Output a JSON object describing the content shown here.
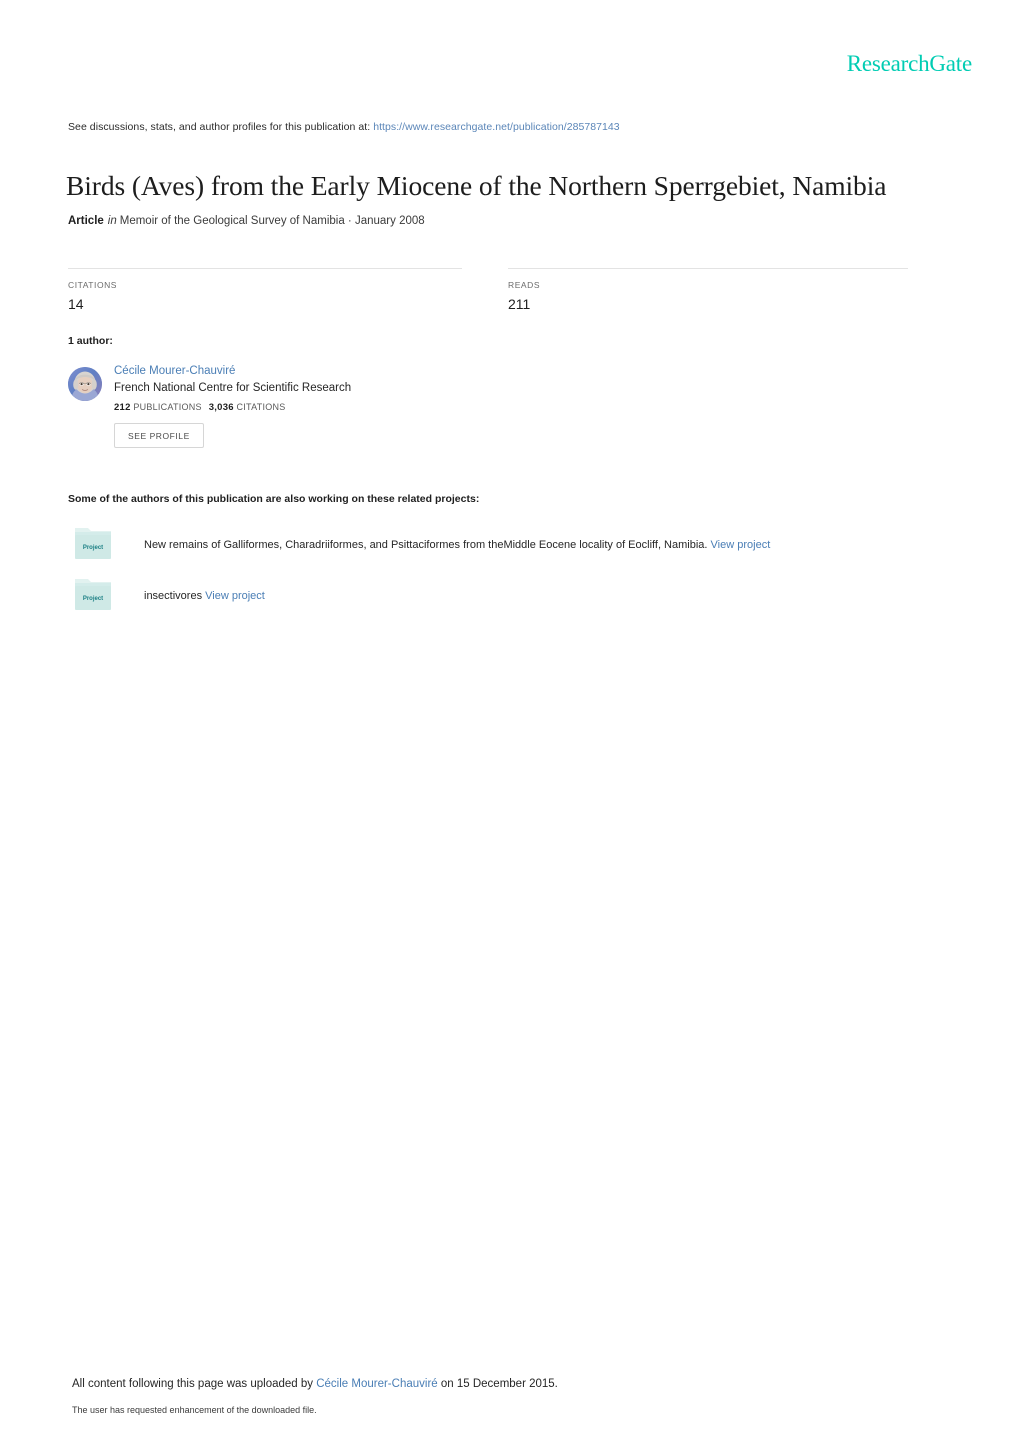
{
  "header": {
    "logo_text": "ResearchGate",
    "logo_color": "#00ccb3"
  },
  "discussions": {
    "prefix": "See discussions, stats, and author profiles for this publication at:",
    "url": "https://www.researchgate.net/publication/285787143"
  },
  "publication": {
    "title": "Birds (Aves) from the Early Miocene of the Northern Sperrgebiet, Namibia",
    "type_label": "Article",
    "in_word": "in",
    "venue": "Memoir of the Geological Survey of Namibia · January 2008"
  },
  "stats": [
    {
      "label": "CITATIONS",
      "value": "14"
    },
    {
      "label": "READS",
      "value": "211"
    }
  ],
  "authors_section": {
    "heading": "1 author:",
    "author": {
      "name": "Cécile Mourer-Chauviré",
      "affiliation": "French National Centre for Scientific Research",
      "publications_count": "212",
      "publications_label": "PUBLICATIONS",
      "citations_count": "3,036",
      "citations_label": "CITATIONS",
      "see_profile_label": "SEE PROFILE"
    }
  },
  "projects_section": {
    "heading": "Some of the authors of this publication are also working on these related projects:",
    "folder_label": "Project",
    "items": [
      {
        "text": "New remains of Galliformes, Charadriiformes, and Psittaciformes from theMiddle Eocene locality of Eocliff, Namibia.",
        "link_label": "View project"
      },
      {
        "text": "insectivores",
        "link_label": "View project"
      }
    ]
  },
  "footer": {
    "upload_prefix": "All content following this page was uploaded by",
    "upload_author": "Cécile Mourer-Chauviré",
    "upload_suffix": "on 15 December 2015.",
    "enhancement_note": "The user has requested enhancement of the downloaded file."
  },
  "colors": {
    "link_blue": "#4a7eb5",
    "url_blue": "#5b86b8",
    "accent_teal": "#00ccb3",
    "folder_teal": "#cfe9e6",
    "rule_grey": "#e3e3e3"
  }
}
